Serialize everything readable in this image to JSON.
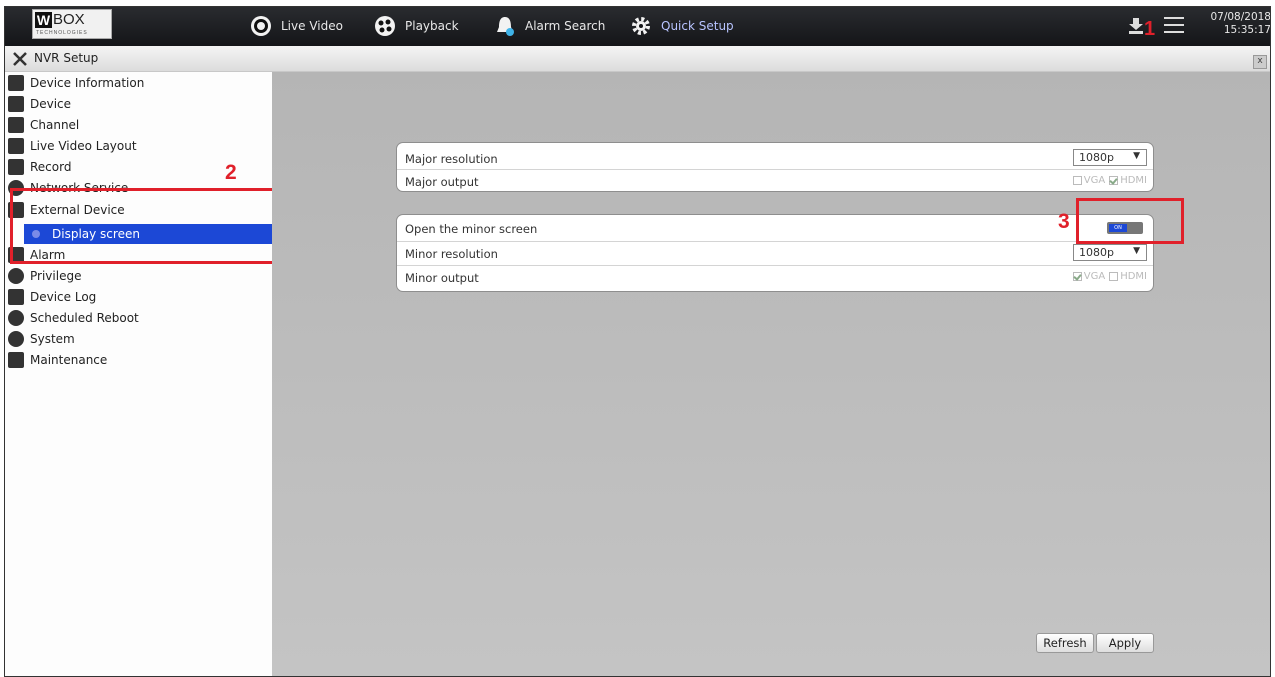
{
  "brand": {
    "logo_main": "BOX",
    "logo_w": "W",
    "logo_sub": "TECHNOLOGIES"
  },
  "topnav": {
    "items": [
      {
        "label": "Live Video",
        "icon": "live-video-icon"
      },
      {
        "label": "Playback",
        "icon": "playback-icon"
      },
      {
        "label": "Alarm Search",
        "icon": "alarm-search-icon"
      },
      {
        "label": "Quick Setup",
        "icon": "quick-setup-icon"
      }
    ],
    "date": "07/08/2018",
    "time": "15:35:17"
  },
  "annotations": {
    "one": "1",
    "two": "2",
    "three": "3"
  },
  "window": {
    "title": "NVR Setup",
    "close": "x"
  },
  "sidebar": {
    "items": [
      {
        "label": "Device Information"
      },
      {
        "label": "Device"
      },
      {
        "label": "Channel"
      },
      {
        "label": "Live Video Layout"
      },
      {
        "label": "Record"
      },
      {
        "label": "Network Service"
      },
      {
        "label": "External Device"
      },
      {
        "label": "Alarm"
      },
      {
        "label": "Privilege"
      },
      {
        "label": "Device Log"
      },
      {
        "label": "Scheduled Reboot"
      },
      {
        "label": "System"
      },
      {
        "label": "Maintenance"
      }
    ],
    "subitem": "Display screen"
  },
  "major": {
    "resolution_label": "Major resolution",
    "resolution_value": "1080p",
    "output_label": "Major output",
    "vga": "VGA",
    "hdmi": "HDMI"
  },
  "minor": {
    "open_label": "Open the minor screen",
    "toggle_text": "ON",
    "resolution_label": "Minor resolution",
    "resolution_value": "1080p",
    "output_label": "Minor output",
    "vga": "VGA",
    "hdmi": "HDMI"
  },
  "buttons": {
    "refresh": "Refresh",
    "apply": "Apply"
  },
  "colors": {
    "selected": "#1c48d6",
    "annotation": "#e0202a",
    "active_nav": "#b8c4ff"
  }
}
